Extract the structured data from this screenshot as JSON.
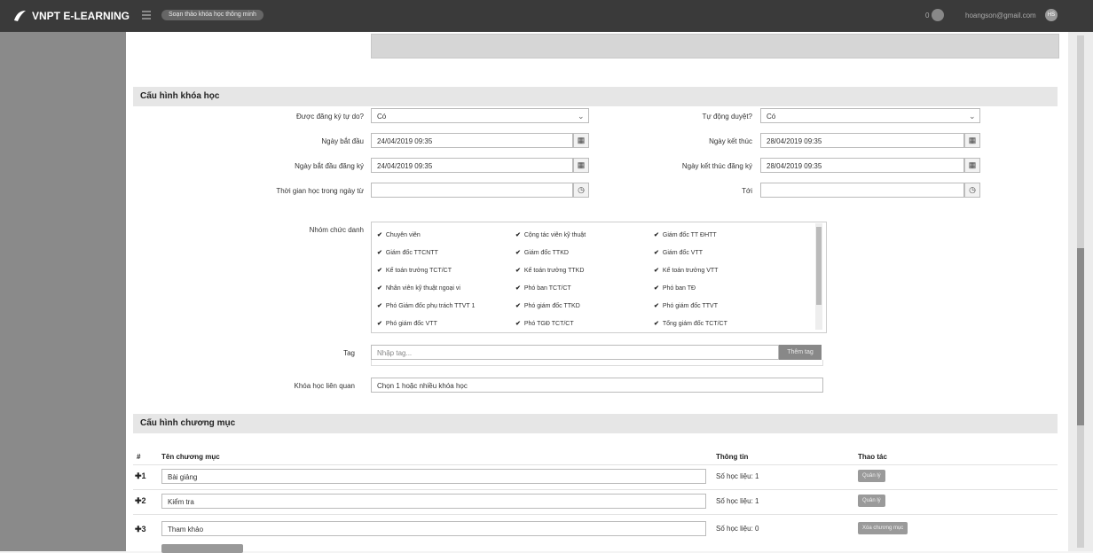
{
  "header": {
    "logo_text": "VNPT E-LEARNING",
    "pill_text": "Soạn thảo khóa học thông minh",
    "notif_count": "0",
    "user_email": "hoangson@gmail.com",
    "avatar_initials": "HS"
  },
  "course_config": {
    "title": "Cấu hình khóa học",
    "self_register_label": "Được đăng ký tự do?",
    "self_register_value": "Có",
    "auto_approve_label": "Tự động duyệt?",
    "auto_approve_value": "Có",
    "start_date_label": "Ngày bắt đầu",
    "start_date_value": "24/04/2019 09:35",
    "end_date_label": "Ngày kết thúc",
    "end_date_value": "28/04/2019 09:35",
    "reg_start_label": "Ngày bắt đầu đăng ký",
    "reg_start_value": "24/04/2019 09:35",
    "reg_end_label": "Ngày kết thúc đăng ký",
    "reg_end_value": "28/04/2019 09:35",
    "study_time_label": "Thời gian học trong ngày từ",
    "study_time_to_label": "Tới",
    "job_groups_label": "Nhóm chức danh",
    "job_groups": [
      "Chuyên viên",
      "Cộng tác viên kỹ thuật",
      "Giám đốc TT ĐHTT",
      "Giám đốc TTCNTT",
      "Giám đốc TTKD",
      "Giám đốc VTT",
      "Kế toán trưởng TCT/CT",
      "Kế toán trưởng TTKD",
      "Kế toán trưởng VTT",
      "Nhân viên kỹ thuật ngoại vi",
      "Phó ban TCT/CT",
      "Phó ban TĐ",
      "Phó Giám đốc phụ trách TTVT 1",
      "Phó giám đốc TTKD",
      "Phó giám đốc TTVT",
      "Phó giám đốc VTT",
      "Phó TGĐ TCT/CT",
      "Tổng giám đốc TCT/CT"
    ],
    "tag_label": "Tag",
    "tag_placeholder": "Nhập tag...",
    "tag_button": "Thêm tag",
    "related_label": "Khóa học liên quan",
    "related_placeholder": "Chọn 1 hoặc nhiều khóa học"
  },
  "chapter_config": {
    "title": "Cấu hình chương mục",
    "col_index": "#",
    "col_name": "Tên chương mục",
    "col_info": "Thông tin",
    "col_action": "Thao tác",
    "rows": [
      {
        "index": "1",
        "name": "Bài giảng",
        "info": "Số học liệu: 1",
        "action": "Quản lý"
      },
      {
        "index": "2",
        "name": "Kiểm tra",
        "info": "Số học liệu: 1",
        "action": "Quản lý"
      },
      {
        "index": "3",
        "name": "Tham khảo",
        "info": "Số học liệu: 0",
        "action": "Xóa chương mục"
      }
    ]
  }
}
